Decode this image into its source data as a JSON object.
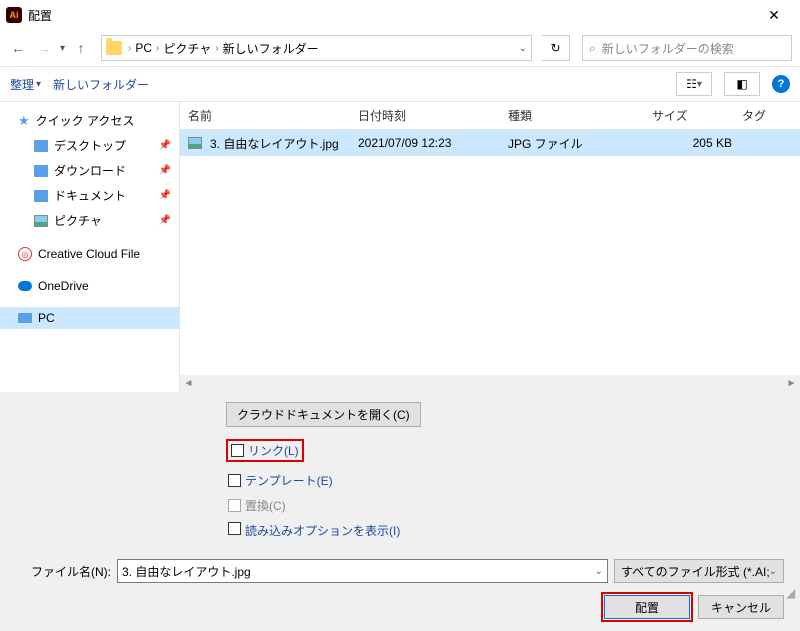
{
  "title": "配置",
  "breadcrumb": {
    "root": "PC",
    "mid": "ピクチャ",
    "leaf": "新しいフォルダー"
  },
  "search": {
    "placeholder": "新しいフォルダーの検索"
  },
  "toolbar": {
    "organize": "整理",
    "new_folder": "新しいフォルダー"
  },
  "columns": {
    "name": "名前",
    "date": "日付時刻",
    "type": "種類",
    "size": "サイズ",
    "tag": "タグ"
  },
  "sidebar": {
    "quick_access": "クイック アクセス",
    "desktop": "デスクトップ",
    "downloads": "ダウンロード",
    "documents": "ドキュメント",
    "pictures": "ピクチャ",
    "creative_cloud": "Creative Cloud File",
    "onedrive": "OneDrive",
    "pc": "PC"
  },
  "file": {
    "name": "3. 自由なレイアウト.jpg",
    "date": "2021/07/09 12:23",
    "type": "JPG ファイル",
    "size": "205 KB"
  },
  "lower": {
    "cloud_doc": "クラウドドキュメントを開く(C)",
    "link": "リンク(L)",
    "template": "テンプレート(E)",
    "replace": "置換(C)",
    "import_opts": "読み込みオプションを表示(I)",
    "filename_label": "ファイル名(N):",
    "filename_value": "3. 自由なレイアウト.jpg",
    "filetype": "すべてのファイル形式 (*.AI;*.AIT;*.PI",
    "place": "配置",
    "cancel": "キャンセル"
  }
}
